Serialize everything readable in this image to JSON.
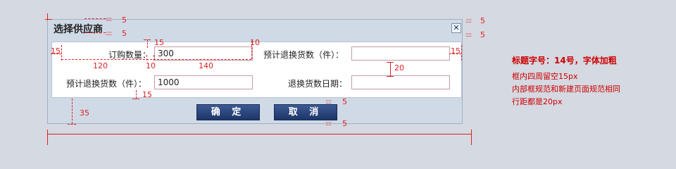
{
  "dialog": {
    "title": "选择供应商",
    "close_glyph": "✕",
    "fields": {
      "order_qty_label": "订购数量：",
      "order_qty_value": "300",
      "est_return_label_1": "预计退换货数（件）：",
      "est_return_value_1": "",
      "est_return_label_2": "预计退换货数（件）：",
      "est_return_value_2": "1000",
      "return_date_label": "退换货数日期：",
      "return_date_value": ""
    },
    "buttons": {
      "confirm": "确 定",
      "cancel": "取 消"
    }
  },
  "annotations": {
    "n5": "5",
    "n15": "15",
    "n10": "10",
    "n120": "120",
    "n140": "140",
    "n20": "20",
    "n35": "35",
    "tick_marks": "::::"
  },
  "notes": {
    "title_spec": "标题字号：14号，字体加粗",
    "line1": "框内四周留空15px",
    "line2": "内部框规范和新建页面规范相同",
    "line3": "行距都是20px"
  }
}
